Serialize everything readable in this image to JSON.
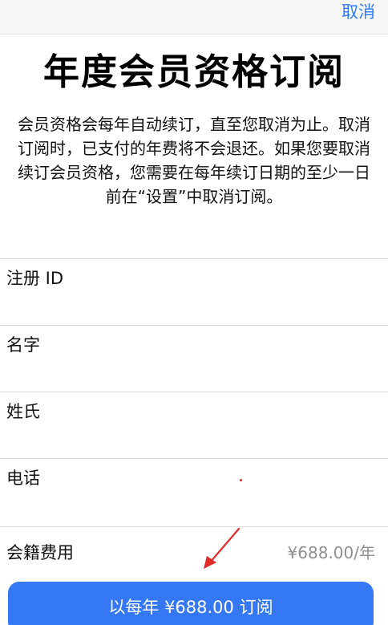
{
  "header": {
    "cancel_label": "取消"
  },
  "title": "年度会员资格订阅",
  "description": "会员资格会每年自动续订，直至您取消为止。取消订阅时，已支付的年费将不会退还。如果您要取消续订会员资格，您需要在每年续订日期的至少一日前在“设置”中取消订阅。",
  "fields": [
    {
      "label": "注册 ID",
      "value": ""
    },
    {
      "label": "名字",
      "value": ""
    },
    {
      "label": "姓氏",
      "value": ""
    },
    {
      "label": "电话",
      "value": ""
    }
  ],
  "fee": {
    "label": "会籍费用",
    "value": "¥688.00/年"
  },
  "subscribe_button": {
    "label": "以每年 ¥688.00 订阅",
    "color": "#3478f6"
  },
  "annotation": {
    "icon": "red-arrow-icon",
    "color": "#e22b2b"
  }
}
